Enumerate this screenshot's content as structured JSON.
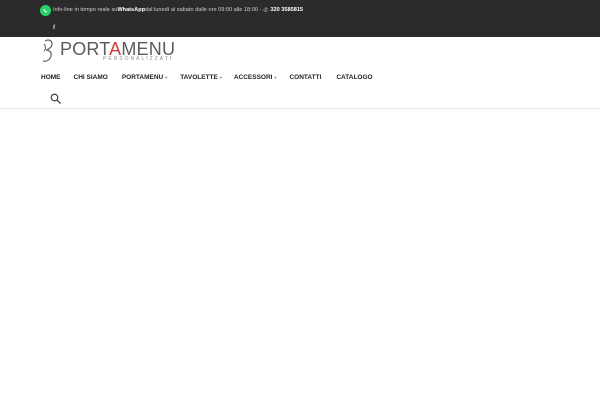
{
  "topbar": {
    "text_before": "Info-line in tempo reale su ",
    "whatsapp": "WhatsApp",
    "text_after": " dal lunedì al sabato dalle ore 09:00 alle 18:00 - ",
    "phone": "320 3585815",
    "icons": {
      "whatsapp": "whatsapp-icon",
      "phone": "phone-icon",
      "facebook": "facebook-icon"
    },
    "colors": {
      "background": "#2b2b2b",
      "whatsapp_green": "#25d366"
    }
  },
  "logo": {
    "word_start": "PORT",
    "word_accent": "A",
    "word_end": "MENU",
    "subtitle": "PERSONALIZZATI",
    "accent_color": "#cf3b3b"
  },
  "nav": {
    "items": [
      {
        "label": "HOME"
      },
      {
        "label": "CHI SIAMO"
      },
      {
        "label": "PORTAMENU"
      },
      {
        "label": "TAVOLETTE"
      },
      {
        "label": "ACCESSORI"
      },
      {
        "label": "CONTATTI"
      },
      {
        "label": "CATALOGO"
      }
    ]
  },
  "search": {
    "icon": "search-icon"
  }
}
